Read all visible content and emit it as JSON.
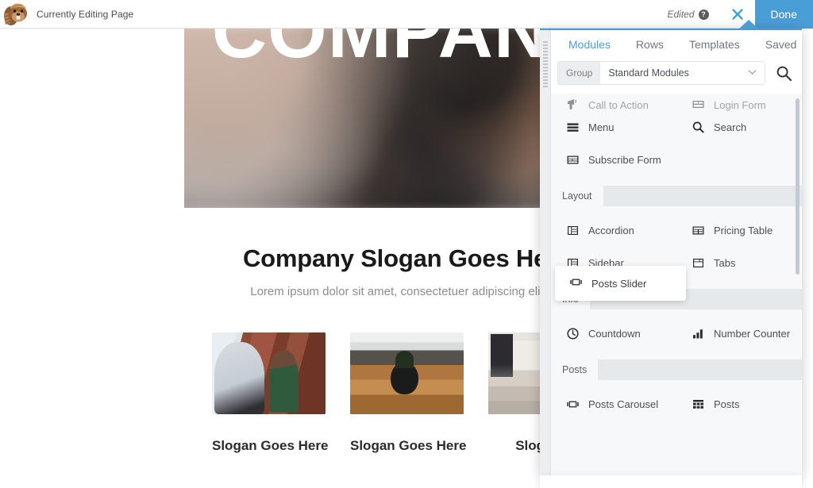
{
  "adminbar": {
    "logo_icon": "beaver-logo-icon",
    "title": "Currently Editing Page",
    "caret_icon": "chevron-down-icon",
    "bell_icon": "notification-bell-icon",
    "edited_label": "Edited",
    "help_icon": "question-mark-icon",
    "close_icon": "close-x-icon",
    "done_label": "Done",
    "accent_color": "#4a9ed8"
  },
  "page": {
    "hero_title": "COMPANY",
    "slogan_heading": "Company Slogan Goes Here",
    "slogan_sub": "Lorem ipsum dolor sit amet, consectetuer adipiscing elit, se",
    "captions": [
      "Slogan Goes Here",
      "Slogan Goes Here",
      "Slogan G"
    ]
  },
  "panel": {
    "grip_icon": "drag-grip-icon",
    "arrow_icon": "panel-pointer-icon",
    "tabs": [
      {
        "label": "Modules",
        "active": true
      },
      {
        "label": "Rows",
        "active": false
      },
      {
        "label": "Templates",
        "active": false
      },
      {
        "label": "Saved",
        "active": false
      }
    ],
    "group_label": "Group",
    "group_value": "Standard Modules",
    "group_caret_icon": "chevron-down-icon",
    "search_icon": "search-icon",
    "sections": [
      {
        "title": "",
        "modules": [
          {
            "label": "Call to Action",
            "icon": "call-to-action-icon",
            "clipped": true
          },
          {
            "label": "Login Form",
            "icon": "login-form-icon",
            "clipped": true
          },
          {
            "label": "Menu",
            "icon": "menu-hamburger-icon",
            "clipped": false
          },
          {
            "label": "Search",
            "icon": "search-icon",
            "clipped": false
          },
          {
            "label": "Subscribe Form",
            "icon": "subscribe-form-icon",
            "clipped": false
          }
        ]
      },
      {
        "title": "Layout",
        "modules": [
          {
            "label": "Accordion",
            "icon": "accordion-icon",
            "clipped": false
          },
          {
            "label": "Pricing Table",
            "icon": "pricing-table-icon",
            "clipped": false
          },
          {
            "label": "Sidebar",
            "icon": "sidebar-icon",
            "clipped": false
          },
          {
            "label": "Tabs",
            "icon": "tabs-icon",
            "clipped": false
          }
        ]
      },
      {
        "title": "Info",
        "modules": [
          {
            "label": "Countdown",
            "icon": "clock-icon",
            "clipped": false
          },
          {
            "label": "Number Counter",
            "icon": "bar-chart-icon",
            "clipped": false
          }
        ]
      },
      {
        "title": "Posts",
        "modules": [
          {
            "label": "Posts Carousel",
            "icon": "carousel-icon",
            "clipped": false
          },
          {
            "label": "Posts",
            "icon": "posts-grid-icon",
            "clipped": false
          }
        ]
      }
    ],
    "dragging": {
      "label": "Posts Slider",
      "icon": "carousel-icon"
    }
  }
}
